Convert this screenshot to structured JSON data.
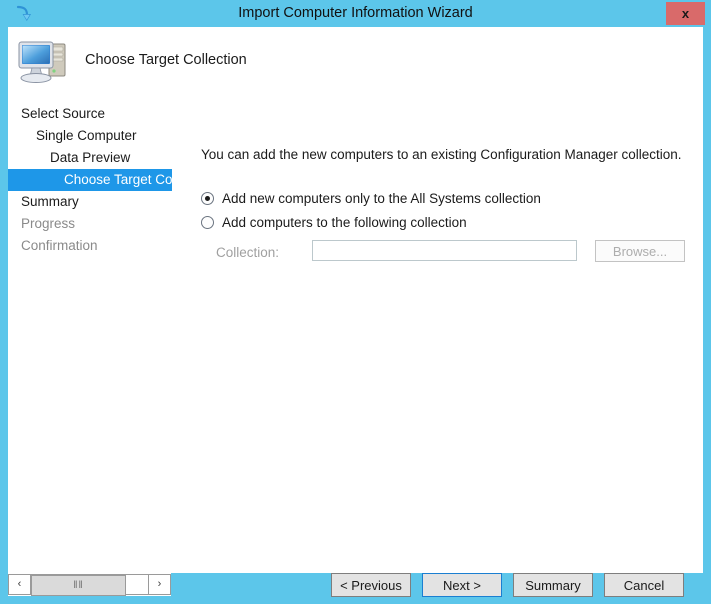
{
  "window": {
    "title": "Import Computer Information Wizard",
    "title_icon": "import-arrow-icon",
    "close_label": "x",
    "frame_color": "#5cc6ea",
    "titlebar_color": "#5cc6ea",
    "close_button_color": "#d96a6a",
    "accent_color": "#1e97e8"
  },
  "header": {
    "icon": "computer-icon",
    "title": "Choose Target Collection"
  },
  "nav": {
    "items": [
      {
        "label": "Select Source",
        "level": 0,
        "state": "dark"
      },
      {
        "label": "Single Computer",
        "level": 1,
        "state": "dark"
      },
      {
        "label": "Data Preview",
        "level": 2,
        "state": "dark"
      },
      {
        "label": "Choose Target Collection",
        "level": 3,
        "state": "selected"
      },
      {
        "label": "Summary",
        "level": 0,
        "state": "dark"
      },
      {
        "label": "Progress",
        "level": 0,
        "state": "dim"
      },
      {
        "label": "Confirmation",
        "level": 0,
        "state": "dim"
      }
    ]
  },
  "main": {
    "intro": "You can add the new computers to an existing Configuration Manager collection.",
    "options": [
      {
        "label": "Add new computers only to the All Systems collection",
        "selected": true
      },
      {
        "label": "Add computers to the following collection",
        "selected": false
      }
    ],
    "collection": {
      "label": "Collection:",
      "value": "",
      "placeholder": "",
      "browse_label": "Browse...",
      "disabled": true
    }
  },
  "footer": {
    "previous_label": "< Previous",
    "next_label": "Next >",
    "summary_label": "Summary",
    "cancel_label": "Cancel"
  },
  "scrollbar": {
    "left_arrow": "‹",
    "right_arrow": "›",
    "grip": "‖‖"
  }
}
